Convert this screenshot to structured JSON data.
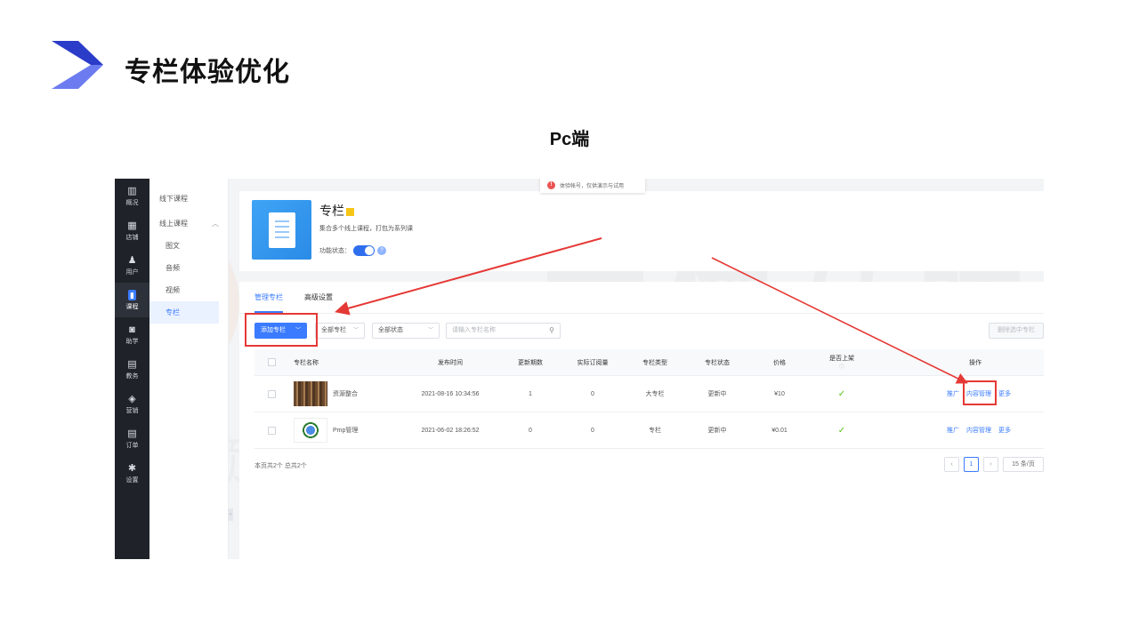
{
  "slide": {
    "title": "专栏体验优化",
    "subtitle": "Pc端",
    "brand_colors": {
      "logo_dark": "#2b3cc9",
      "logo_light": "#6c7cf0",
      "annotation": "#e53935"
    }
  },
  "watermark": {
    "logo_text": "关橘互联",
    "line_text": "国内领先的数字化营销服务商"
  },
  "notice": {
    "text": "体验帐号，仅供演示与试用"
  },
  "nav": {
    "items": [
      {
        "icon": "chart-icon",
        "glyph": "▥",
        "label": "概况"
      },
      {
        "icon": "store-icon",
        "glyph": "▦",
        "label": "店铺"
      },
      {
        "icon": "users-icon",
        "glyph": "♟",
        "label": "用户"
      },
      {
        "icon": "course-icon",
        "glyph": "▮",
        "label": "课程"
      },
      {
        "icon": "assist-icon",
        "glyph": "◙",
        "label": "助学"
      },
      {
        "icon": "edu-icon",
        "glyph": "▤",
        "label": "教务"
      },
      {
        "icon": "tag-icon",
        "glyph": "◈",
        "label": "营销"
      },
      {
        "icon": "order-icon",
        "glyph": "▤",
        "label": "订单"
      },
      {
        "icon": "gear-icon",
        "glyph": "✱",
        "label": "设置"
      }
    ]
  },
  "subnav": {
    "offline": "线下课程",
    "online": "线上课程",
    "children": [
      "图文",
      "音频",
      "视频",
      "专栏"
    ]
  },
  "card": {
    "title": "专栏",
    "description": "集合多个线上课程，打包为系列课",
    "status_label": "功能状态："
  },
  "tabs": [
    "管理专栏",
    "高级设置"
  ],
  "toolbar": {
    "add_label": "添加专栏",
    "filter_column": "全部专栏",
    "filter_status": "全部状态",
    "search_placeholder": "请输入专栏名称",
    "delete_label": "删除选中专栏"
  },
  "table": {
    "headers": [
      "专栏名称",
      "发布时间",
      "更新期数",
      "实际订阅量",
      "专栏类型",
      "专栏状态",
      "价格",
      "是否上架",
      "操作"
    ],
    "rows": [
      {
        "name": "资源整合",
        "time": "2021-08-16 10:34:56",
        "periods": "1",
        "subs": "0",
        "type": "大专栏",
        "status": "更新中",
        "price": "¥10",
        "listed": "✓"
      },
      {
        "name": "Pmp管理",
        "time": "2021-06-02 18:26:52",
        "periods": "0",
        "subs": "0",
        "type": "专栏",
        "status": "更新中",
        "price": "¥0.01",
        "listed": "✓"
      }
    ],
    "actions": [
      "推广",
      "内容管理",
      "更多"
    ]
  },
  "footer": {
    "count_text": "本页共2个 总共2个",
    "prev": "‹",
    "page": "1",
    "next": "›",
    "page_size": "15 条/页"
  }
}
